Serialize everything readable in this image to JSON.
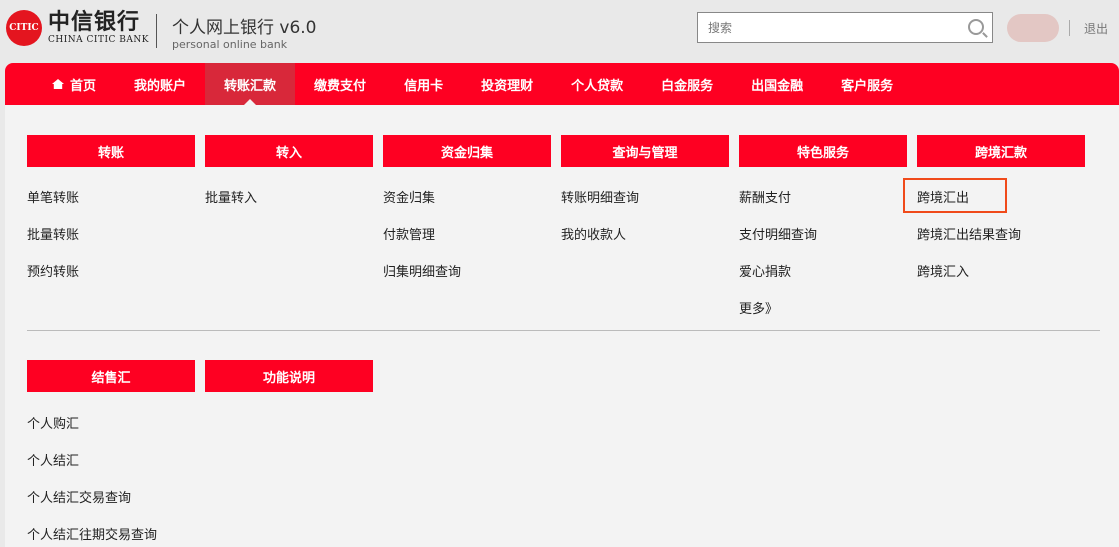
{
  "header": {
    "logo_cn": "中信银行",
    "logo_en": "CHINA CITIC BANK",
    "logo_mark": "CITIC",
    "title": "个人网上银行 v6.0",
    "subtitle": "personal online bank",
    "search_placeholder": "搜索",
    "logout": "退出"
  },
  "nav": {
    "items": [
      "首页",
      "我的账户",
      "转账汇款",
      "缴费支付",
      "信用卡",
      "投资理财",
      "个人贷款",
      "白金服务",
      "出国金融",
      "客户服务"
    ],
    "active": "转账汇款"
  },
  "menu": {
    "columns": [
      {
        "header": "转账",
        "items": [
          "单笔转账",
          "批量转账",
          "预约转账"
        ]
      },
      {
        "header": "转入",
        "items": [
          "批量转入"
        ]
      },
      {
        "header": "资金归集",
        "items": [
          "资金归集",
          "付款管理",
          "归集明细查询"
        ]
      },
      {
        "header": "查询与管理",
        "items": [
          "转账明细查询",
          "我的收款人"
        ]
      },
      {
        "header": "特色服务",
        "items": [
          "薪酬支付",
          "支付明细查询",
          "爱心捐款",
          "更多》"
        ]
      },
      {
        "header": "跨境汇款",
        "items": [
          "跨境汇出",
          "跨境汇出结果查询",
          "跨境汇入"
        ]
      }
    ],
    "columns2": [
      {
        "header": "结售汇",
        "items": [
          "个人购汇",
          "个人结汇",
          "个人结汇交易查询",
          "个人结汇往期交易查询"
        ]
      },
      {
        "header": "功能说明",
        "items": []
      }
    ],
    "highlighted": "跨境汇出"
  },
  "colors": {
    "brand_red": "#fe0022",
    "active_tab": "#d8283a",
    "highlight_border": "#f04a1a"
  }
}
